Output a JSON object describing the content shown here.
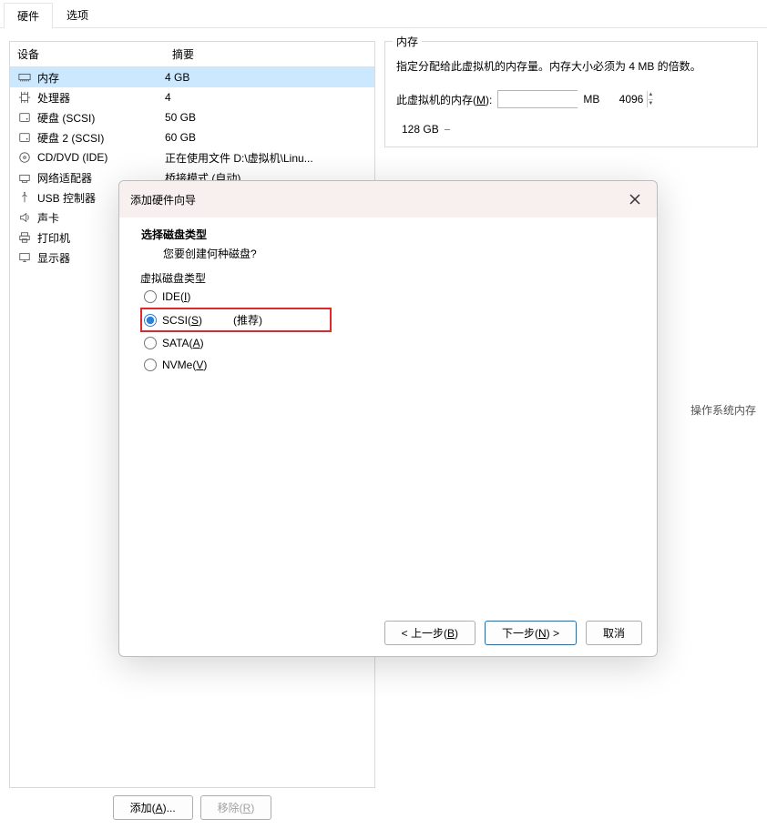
{
  "tabs": {
    "hardware": "硬件",
    "options": "选项"
  },
  "table": {
    "head_device": "设备",
    "head_summary": "摘要",
    "rows": [
      {
        "icon": "memory",
        "name": "内存",
        "summary": "4 GB",
        "selected": true
      },
      {
        "icon": "cpu",
        "name": "处理器",
        "summary": "4"
      },
      {
        "icon": "hdd",
        "name": "硬盘 (SCSI)",
        "summary": "50 GB"
      },
      {
        "icon": "hdd",
        "name": "硬盘 2 (SCSI)",
        "summary": "60 GB"
      },
      {
        "icon": "cd",
        "name": "CD/DVD (IDE)",
        "summary": "正在使用文件 D:\\虚拟机\\Linu..."
      },
      {
        "icon": "net",
        "name": "网络适配器",
        "summary": "桥接模式 (自动)"
      },
      {
        "icon": "usb",
        "name": "USB 控制器",
        "summary": ""
      },
      {
        "icon": "sound",
        "name": "声卡",
        "summary": ""
      },
      {
        "icon": "printer",
        "name": "打印机",
        "summary": ""
      },
      {
        "icon": "display",
        "name": "显示器",
        "summary": ""
      }
    ]
  },
  "actions": {
    "add": "添加(",
    "add_key": "A",
    "add_suffix": ")...",
    "remove": "移除(",
    "remove_key": "R",
    "remove_suffix": ")"
  },
  "memory": {
    "legend": "内存",
    "desc": "指定分配给此虚拟机的内存量。内存大小必须为 4 MB 的倍数。",
    "label_prefix": "此虚拟机的内存(",
    "label_key": "M",
    "label_suffix": "):",
    "value": "4096",
    "unit": "MB",
    "scale_top": "128 GB",
    "os_text": "操作系统内存"
  },
  "dialog": {
    "title": "添加硬件向导",
    "heading": "选择磁盘类型",
    "sub": "您要创建何种磁盘?",
    "group_legend": "虚拟磁盘类型",
    "opts": {
      "ide": {
        "pre": "IDE(",
        "key": "I",
        "post": ")"
      },
      "scsi": {
        "pre": "SCSI(",
        "key": "S",
        "post": ")",
        "recommend": "(推荐)"
      },
      "sata": {
        "pre": "SATA(",
        "key": "A",
        "post": ")"
      },
      "nvme": {
        "pre": "NVMe(",
        "key": "V",
        "post": ")"
      }
    },
    "buttons": {
      "back": {
        "pre": "< 上一步(",
        "key": "B",
        "post": ")"
      },
      "next": {
        "pre": "下一步(",
        "key": "N",
        "post": ") >"
      },
      "cancel": "取消"
    }
  }
}
